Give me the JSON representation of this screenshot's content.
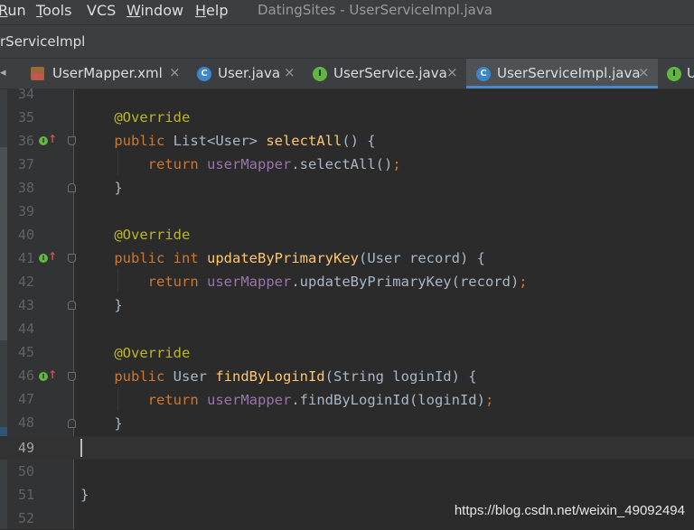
{
  "menu": [
    {
      "text": "Run",
      "ul": "R",
      "rest": "un"
    },
    {
      "text": "Tools",
      "ul": "T",
      "rest": "ools"
    },
    {
      "text": "VCS",
      "ul": "",
      "rest": "VCS"
    },
    {
      "text": "Window",
      "ul": "W",
      "rest": "indow"
    },
    {
      "text": "Help",
      "ul": "H",
      "rest": "elp"
    }
  ],
  "window_title": "DatingSites - UserServiceImpl.java",
  "nav_label": "rServiceImpl",
  "tabs": [
    {
      "label": "UserMapper.xml",
      "icon": "xml-file-icon",
      "close": "×"
    },
    {
      "label": "User.java",
      "icon": "class-icon",
      "icon_letter": "C",
      "close": "×"
    },
    {
      "label": "UserService.java",
      "icon": "interface-icon",
      "icon_letter": "I",
      "close": "×"
    },
    {
      "label": "UserServiceImpl.java",
      "icon": "class-icon",
      "icon_letter": "C",
      "close": "×",
      "active": true
    },
    {
      "label": "U",
      "icon": "interface-icon",
      "icon_letter": "I"
    }
  ],
  "line_numbers": [
    "34",
    "35",
    "36",
    "37",
    "38",
    "39",
    "40",
    "41",
    "42",
    "43",
    "44",
    "45",
    "46",
    "47",
    "48",
    "49",
    "50",
    "51",
    "52"
  ],
  "current_line": "49",
  "code": {
    "annotation": "@Override",
    "kw_public": "public",
    "kw_return": "return",
    "kw_int": "int",
    "field_usermapper": "userMapper",
    "semicolon": ";",
    "l36_type": " List<User> ",
    "l36_method": "selectAll",
    "l36_rest": "() {",
    "l37_rest": ".selectAll()",
    "close_brace": "}",
    "l41_method": "updateByPrimaryKey",
    "l41_rest": "(User record) {",
    "l42_rest": ".updateByPrimaryKey(record)",
    "l46_type": " User ",
    "l46_method": "findByLoginId",
    "l46_rest": "(String loginId) {",
    "l47_rest": ".findByLoginId(loginId)"
  },
  "watermark": "https://blog.csdn.net/weixin_49092494"
}
